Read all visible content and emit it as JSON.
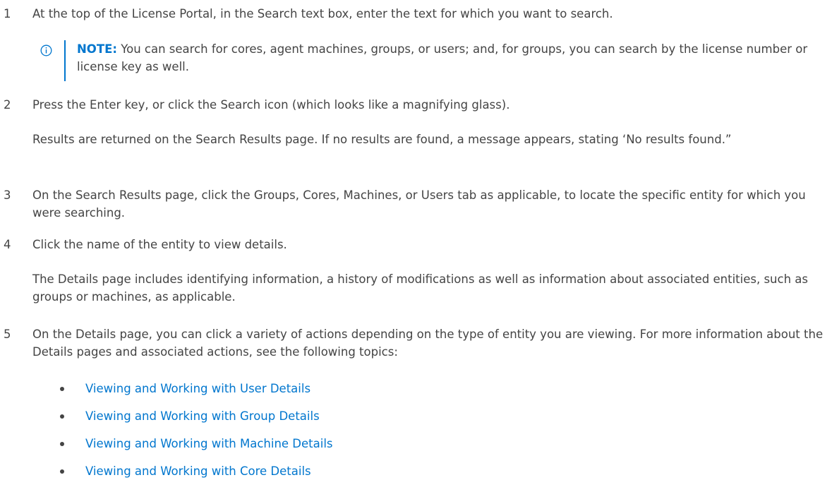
{
  "steps": [
    {
      "num": "1",
      "text": "At the top of the License Portal, in the Search text box, enter the text for which you want to search."
    },
    {
      "num": "2",
      "text": "Press the Enter key, or click the Search icon (which looks like a magnifying glass).",
      "result": "Results are returned on the Search Results page. If no results are found, a message appears, stating ‘No results found.”"
    },
    {
      "num": "3",
      "text": "On the Search Results page, click the Groups, Cores, Machines, or Users tab as applicable, to locate the specific entity for which you were searching."
    },
    {
      "num": "4",
      "text": "Click the name of the entity to view details.",
      "result": "The Details page includes identifying information, a history of modifications as well as information about associated entities, such as groups or machines, as applicable."
    },
    {
      "num": "5",
      "text": "On the Details page, you can click a variety of actions depending on the type of entity you are viewing. For more information about the Details pages and associated actions, see the following topics:"
    }
  ],
  "note": {
    "label": "NOTE:",
    "text": "You can search for cores, agent machines, groups, or users; and, for groups, you can search by the license number or license key as well.",
    "icon": "info-icon",
    "accent_color": "#0076ce"
  },
  "links": [
    "Viewing and Working with User Details",
    "Viewing and Working with Group Details",
    "Viewing and Working with Machine Details",
    "Viewing and Working with Core Details"
  ],
  "colors": {
    "text": "#444444",
    "link": "#0076ce"
  }
}
